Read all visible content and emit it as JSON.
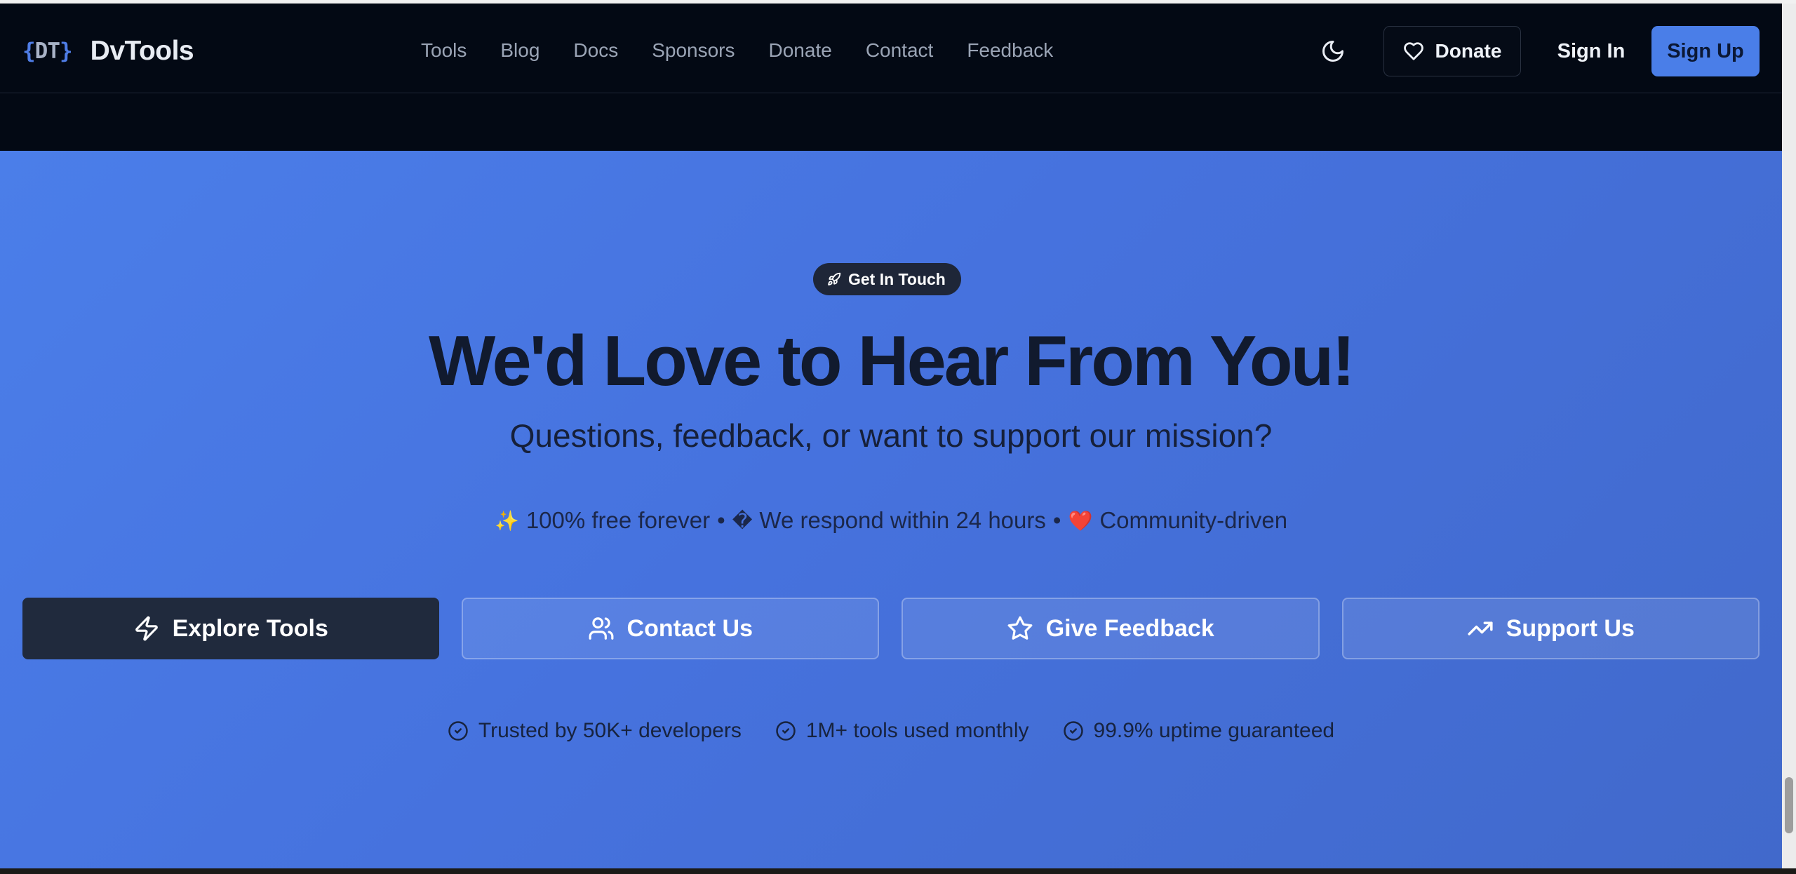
{
  "brand": {
    "mark_open": "{",
    "mark_letters": "DT",
    "mark_close": "}",
    "name": "DvTools"
  },
  "nav": {
    "links": [
      "Tools",
      "Blog",
      "Docs",
      "Sponsors",
      "Donate",
      "Contact",
      "Feedback"
    ]
  },
  "header_actions": {
    "theme_toggle_icon": "moon-icon",
    "donate_label": "Donate",
    "signin_label": "Sign In",
    "signup_label": "Sign Up"
  },
  "hero": {
    "badge_icon": "rocket-icon",
    "badge_label": "Get In Touch",
    "title": "We'd Love to Hear From You!",
    "subtitle": "Questions, feedback, or want to support our mission?",
    "highlights": {
      "item1_icon": "✨",
      "item1_text": "100% free forever",
      "separator": "•",
      "item2_icon": "�",
      "item2_text": "We respond within 24 hours",
      "item3_icon": "❤️",
      "item3_text": "Community-driven"
    },
    "cta": {
      "explore_label": "Explore Tools",
      "explore_icon": "lightning-icon",
      "contact_label": "Contact Us",
      "contact_icon": "users-icon",
      "feedback_label": "Give Feedback",
      "feedback_icon": "star-icon",
      "support_label": "Support Us",
      "support_icon": "trending-up-icon"
    },
    "trust": {
      "item1": "Trusted by 50K+ developers",
      "item2": "1M+ tools used monthly",
      "item3": "99.9% uptime guaranteed",
      "icon": "check-circle-icon"
    }
  },
  "colors": {
    "header_bg": "#030914",
    "accent": "#4a7ee8",
    "hero_gradient_start": "#4b7ee9",
    "hero_gradient_end": "#4169cb",
    "primary_button": "#202a3d",
    "title_text": "#111a2e"
  }
}
